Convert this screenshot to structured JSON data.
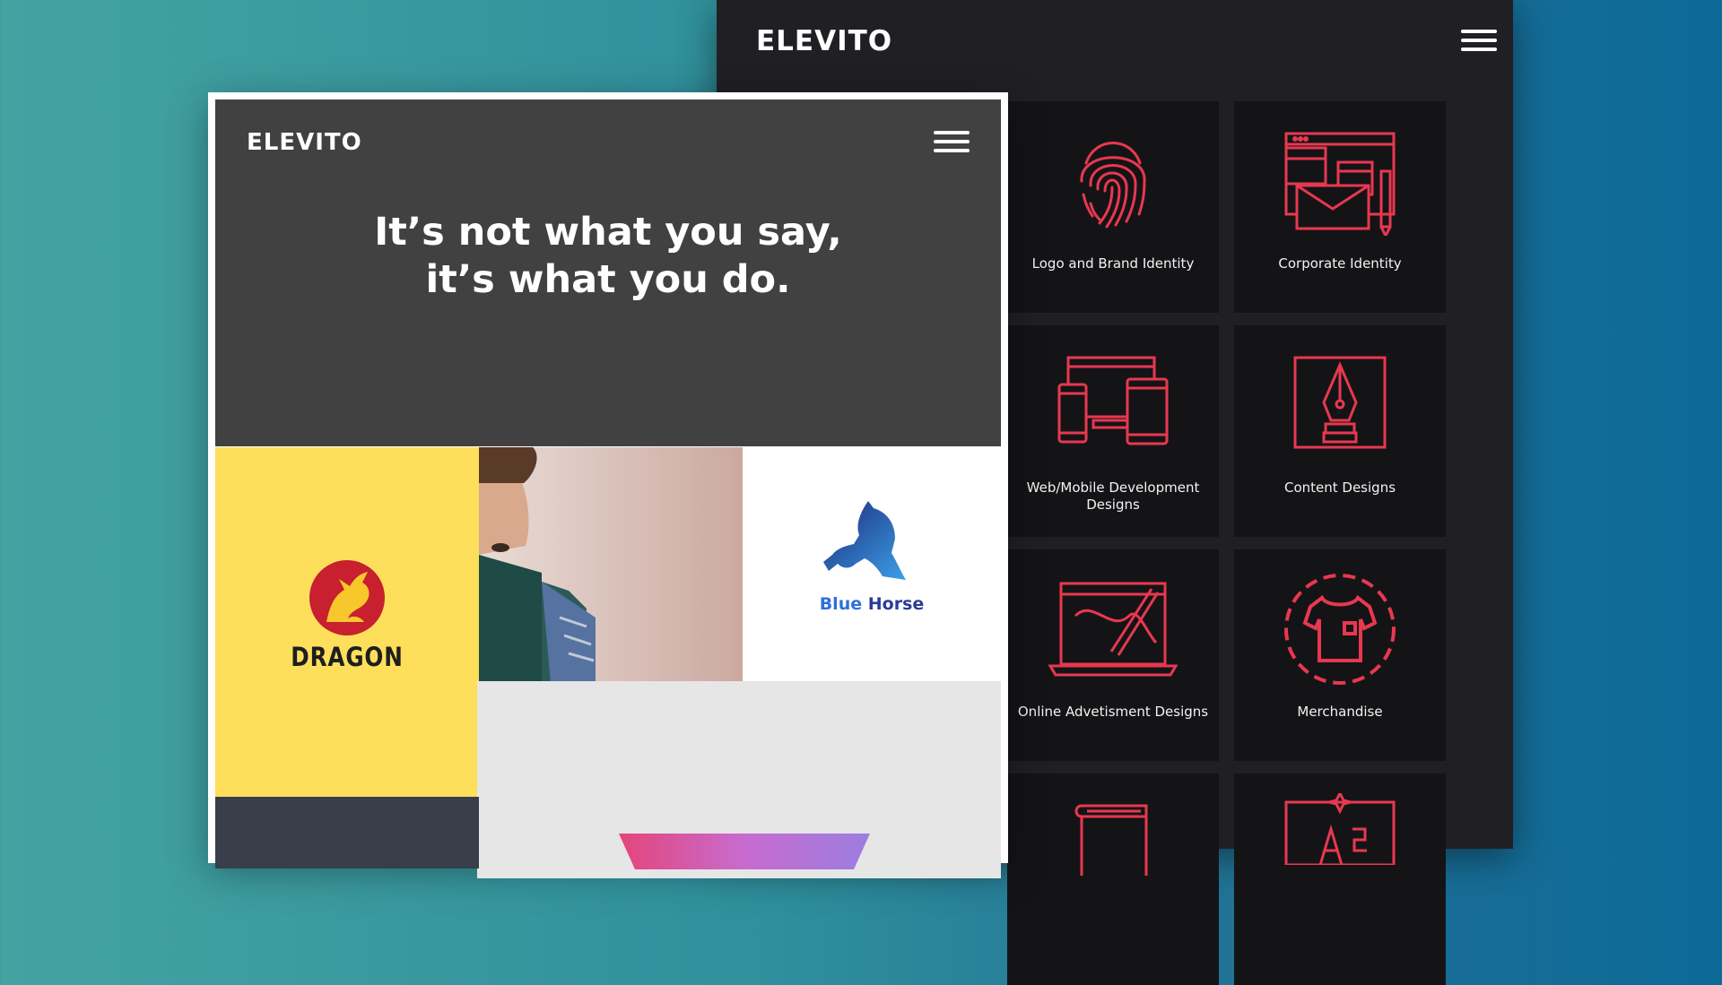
{
  "colors": {
    "accent": "#e8384f",
    "background_left": "#44a3a1",
    "background_right": "#0c6a98",
    "dark_panel": "#202024",
    "card": "#141417",
    "hero": "#414141",
    "dragon_tile": "#fddf5c"
  },
  "back_site": {
    "logo": "ELEVITO",
    "menu_icon": "hamburger-icon",
    "services": [
      {
        "label": "Logo and Brand Identity",
        "icon": "fingerprint-icon"
      },
      {
        "label": "Corporate Identity",
        "icon": "stationery-icon"
      },
      {
        "label": "Web/Mobile Development Designs",
        "icon": "devices-icon"
      },
      {
        "label": "Content Designs",
        "icon": "pen-nib-icon"
      },
      {
        "label": "Online Advetisment Designs",
        "icon": "laptop-drawing-icon"
      },
      {
        "label": "Merchandise",
        "icon": "tshirt-icon"
      },
      {
        "label": "",
        "icon": "book-icon"
      },
      {
        "label": "",
        "icon": "design-tools-icon"
      }
    ]
  },
  "front_site": {
    "logo": "ELEVITO",
    "menu_icon": "hamburger-icon",
    "headline_line1": "It’s not what you say,",
    "headline_line2": "it’s what you do.",
    "portfolio": {
      "dragon_brand": "DRAGON",
      "horse_brand_word1": "Blue",
      "horse_brand_word2": "Horse"
    }
  }
}
